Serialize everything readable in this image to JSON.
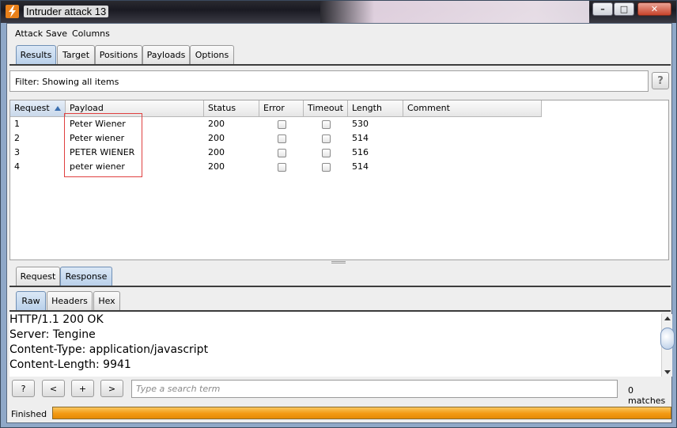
{
  "window": {
    "title": "Intruder attack 13",
    "min_symbol": "–",
    "max_symbol": "□",
    "close_symbol": "✕"
  },
  "menu": [
    "Attack",
    "Save",
    "Columns"
  ],
  "main_tabs": [
    {
      "label": "Results",
      "active": true
    },
    {
      "label": "Target",
      "active": false
    },
    {
      "label": "Positions",
      "active": false
    },
    {
      "label": "Payloads",
      "active": false
    },
    {
      "label": "Options",
      "active": false
    }
  ],
  "filter": {
    "text": "Filter:  Showing all items",
    "help_label": "?"
  },
  "results_table": {
    "columns": [
      "Request",
      "Payload",
      "Status",
      "Error",
      "Timeout",
      "Length",
      "Comment"
    ],
    "sorted_column": "Request",
    "rows": [
      {
        "request": "1",
        "payload": "Peter Wiener",
        "status": "200",
        "error": false,
        "timeout": false,
        "length": "530",
        "comment": ""
      },
      {
        "request": "2",
        "payload": "Peter wiener",
        "status": "200",
        "error": false,
        "timeout": false,
        "length": "514",
        "comment": ""
      },
      {
        "request": "3",
        "payload": "PETER WIENER",
        "status": "200",
        "error": false,
        "timeout": false,
        "length": "516",
        "comment": ""
      },
      {
        "request": "4",
        "payload": "peter wiener",
        "status": "200",
        "error": false,
        "timeout": false,
        "length": "514",
        "comment": ""
      }
    ]
  },
  "detail_tabs": [
    {
      "label": "Request",
      "active": false
    },
    {
      "label": "Response",
      "active": true
    }
  ],
  "view_tabs": [
    {
      "label": "Raw",
      "active": true
    },
    {
      "label": "Headers",
      "active": false
    },
    {
      "label": "Hex",
      "active": false
    }
  ],
  "response_lines": [
    "HTTP/1.1 200 OK",
    "Server: Tengine",
    "Content-Type: application/javascript",
    "Content-Length: 9941"
  ],
  "search": {
    "help_label": "?",
    "prev_label": "<",
    "add_label": "+",
    "next_label": ">",
    "placeholder": "Type a search term",
    "matches": "0 matches"
  },
  "status": {
    "label": "Finished",
    "progress": 1.0
  },
  "colors": {
    "progress_fill": "#f39a13",
    "active_tab": "#b9d0ea",
    "highlight_box": "#e04040"
  }
}
